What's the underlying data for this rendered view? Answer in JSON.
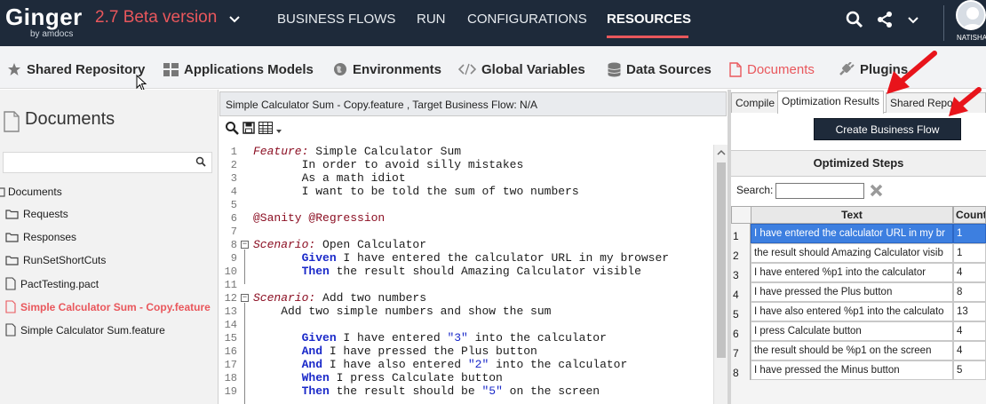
{
  "topbar": {
    "logo": "Ginger",
    "logo_sub": "by amdocs",
    "version": "2.7 Beta version",
    "nav": [
      "BUSINESS FLOWS",
      "RUN",
      "CONFIGURATIONS",
      "RESOURCES"
    ],
    "active_nav": "RESOURCES",
    "user_name": "NATISHA"
  },
  "subbar": {
    "items": [
      {
        "label": "Shared Repository",
        "icon": "star-icon"
      },
      {
        "label": "Applications Models",
        "icon": "grid-icon"
      },
      {
        "label": "Environments",
        "icon": "globe-icon"
      },
      {
        "label": "Global  Variables",
        "icon": "code-icon"
      },
      {
        "label": "Data Sources",
        "icon": "database-icon"
      },
      {
        "label": "Documents",
        "icon": "document-icon"
      },
      {
        "label": "Plugins",
        "icon": "plug-icon"
      }
    ],
    "active": "Documents"
  },
  "left": {
    "title": "Documents",
    "search_value": "",
    "root": "Documents",
    "items": [
      {
        "label": "Requests",
        "type": "folder"
      },
      {
        "label": "Responses",
        "type": "folder"
      },
      {
        "label": "RunSetShortCuts",
        "type": "folder"
      },
      {
        "label": "PactTesting.pact",
        "type": "file"
      },
      {
        "label": "Simple Calculator Sum - Copy.feature",
        "type": "file"
      },
      {
        "label": "Simple Calculator Sum.feature",
        "type": "file"
      }
    ]
  },
  "editor": {
    "header": "Simple Calculator Sum - Copy.feature , Target Business Flow: N/A",
    "lines": [
      {
        "n": "1",
        "parts": [
          [
            "kw",
            "Feature:"
          ],
          [
            "",
            " Simple Calculator Sum"
          ]
        ]
      },
      {
        "n": "2",
        "parts": [
          [
            "",
            "       In order to avoid silly mistakes"
          ]
        ]
      },
      {
        "n": "3",
        "parts": [
          [
            "",
            "       As a math idiot"
          ]
        ]
      },
      {
        "n": "4",
        "parts": [
          [
            "",
            "       I want to be told the sum of two numbers"
          ]
        ]
      },
      {
        "n": "5",
        "parts": [
          [
            "",
            ""
          ]
        ]
      },
      {
        "n": "6",
        "parts": [
          [
            "tag",
            "@Sanity @Regression"
          ]
        ]
      },
      {
        "n": "7",
        "parts": [
          [
            "",
            ""
          ]
        ]
      },
      {
        "n": "8",
        "parts": [
          [
            "kw",
            "Scenario:"
          ],
          [
            "",
            " Open Calculator"
          ]
        ]
      },
      {
        "n": "9",
        "parts": [
          [
            "",
            "       "
          ],
          [
            "kw2",
            "Given"
          ],
          [
            "",
            " I have entered the calculator URL in my browser"
          ]
        ]
      },
      {
        "n": "10",
        "parts": [
          [
            "",
            "       "
          ],
          [
            "kw2",
            "Then"
          ],
          [
            "",
            " the result should Amazing Calculator visible"
          ]
        ]
      },
      {
        "n": "11",
        "parts": [
          [
            "",
            ""
          ]
        ]
      },
      {
        "n": "12",
        "parts": [
          [
            "kw",
            "Scenario:"
          ],
          [
            "",
            " Add two numbers"
          ]
        ]
      },
      {
        "n": "13",
        "parts": [
          [
            "",
            "    Add two simple numbers and show the sum"
          ]
        ]
      },
      {
        "n": "14",
        "parts": [
          [
            "",
            ""
          ]
        ]
      },
      {
        "n": "15",
        "parts": [
          [
            "",
            "       "
          ],
          [
            "kw2",
            "Given"
          ],
          [
            "",
            " I have entered "
          ],
          [
            "str",
            "\"3\""
          ],
          [
            "",
            " into the calculator"
          ]
        ]
      },
      {
        "n": "16",
        "parts": [
          [
            "",
            "       "
          ],
          [
            "kw2",
            "And"
          ],
          [
            "",
            " I have pressed the Plus button"
          ]
        ]
      },
      {
        "n": "17",
        "parts": [
          [
            "",
            "       "
          ],
          [
            "kw2",
            "And"
          ],
          [
            "",
            " I have also entered "
          ],
          [
            "str",
            "\"2\""
          ],
          [
            "",
            " into the calculator"
          ]
        ]
      },
      {
        "n": "18",
        "parts": [
          [
            "",
            "       "
          ],
          [
            "kw2",
            "When"
          ],
          [
            "",
            " I press Calculate button"
          ]
        ]
      },
      {
        "n": "19",
        "parts": [
          [
            "",
            "       "
          ],
          [
            "kw2",
            "Then"
          ],
          [
            "",
            " the result should be "
          ],
          [
            "str",
            "\"5\""
          ],
          [
            "",
            " on the screen"
          ]
        ]
      }
    ]
  },
  "right": {
    "tabs": [
      "Compile",
      "Optimization Results",
      "Shared Repos"
    ],
    "active_tab": "Optimization Results",
    "create_button": "Create Business Flow",
    "section_title": "Optimized Steps",
    "search_label": "Search:",
    "search_value": "",
    "columns": [
      "Text",
      "Count"
    ],
    "rows": [
      {
        "n": "1",
        "text": "I have entered the calculator URL in my br",
        "count": "1"
      },
      {
        "n": "2",
        "text": "the result should Amazing Calculator visib",
        "count": "1"
      },
      {
        "n": "3",
        "text": "I have entered %p1 into the calculator",
        "count": "4"
      },
      {
        "n": "4",
        "text": "I have pressed the Plus button",
        "count": "8"
      },
      {
        "n": "5",
        "text": "I have also entered %p1 into the calculato",
        "count": "13"
      },
      {
        "n": "6",
        "text": "I press Calculate button",
        "count": "4"
      },
      {
        "n": "7",
        "text": "the result should be %p1 on the screen",
        "count": "4"
      },
      {
        "n": "8",
        "text": "I have pressed the Minus button",
        "count": "5"
      }
    ]
  },
  "colors": {
    "accent": "#e9575c",
    "topbar": "#1e2a3a",
    "selected_row": "#3d7fe0",
    "annotation_arrow": "#e8141b"
  }
}
